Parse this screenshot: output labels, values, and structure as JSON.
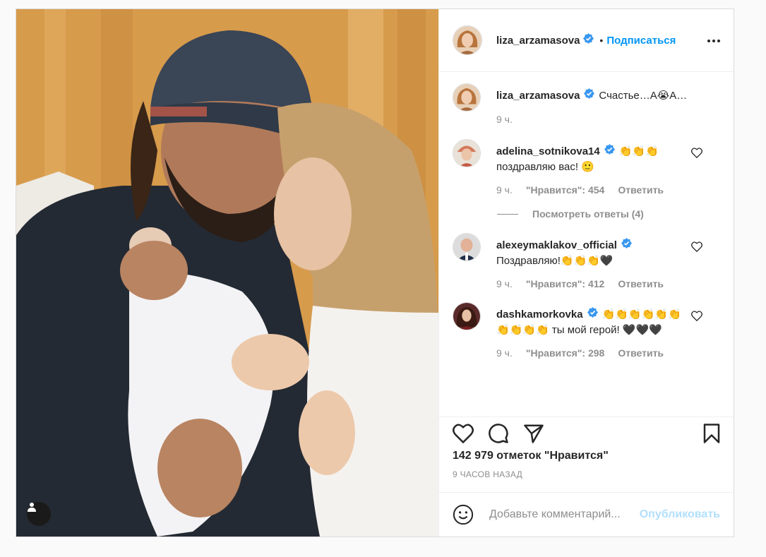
{
  "post": {
    "username": "liza_arzamasova",
    "follow_label": "Подписаться",
    "dot": "•",
    "caption": "Счастье…А😭А…",
    "caption_time": "9 ч.",
    "likes_text": "142 979 отметок \"Нравится\"",
    "time_ago": "9 ЧАСОВ НАЗАД",
    "comment_placeholder": "Добавьте комментарий...",
    "publish_label": "Опубликовать"
  },
  "comments": [
    {
      "username": "adelina_sotnikova14",
      "text": "👏👏👏 поздравляю вас! 🙂",
      "time": "9 ч.",
      "likes": "\"Нравится\": 454",
      "reply": "Ответить",
      "view_replies": "Посмотреть ответы (4)"
    },
    {
      "username": "alexeymaklakov_official",
      "text": "Поздравляю!👏👏👏🖤",
      "time": "9 ч.",
      "likes": "\"Нравится\": 412",
      "reply": "Ответить"
    },
    {
      "username": "dashkamorkovka",
      "text": "👏👏👏👏👏👏👏👏👏👏 ты мой герой! 🖤🖤🖤",
      "time": "9 ч.",
      "likes": "\"Нравится\": 298",
      "reply": "Ответить"
    }
  ],
  "colors": {
    "accent": "#0095f6",
    "verified": "#3897f0",
    "muted": "#8e8e8e",
    "publish_disabled": "#b2dffc"
  },
  "icons": [
    "more-icon",
    "verified-icon",
    "heart-icon",
    "comment-icon",
    "share-icon",
    "bookmark-icon",
    "emoji-icon",
    "user-tag-icon"
  ]
}
